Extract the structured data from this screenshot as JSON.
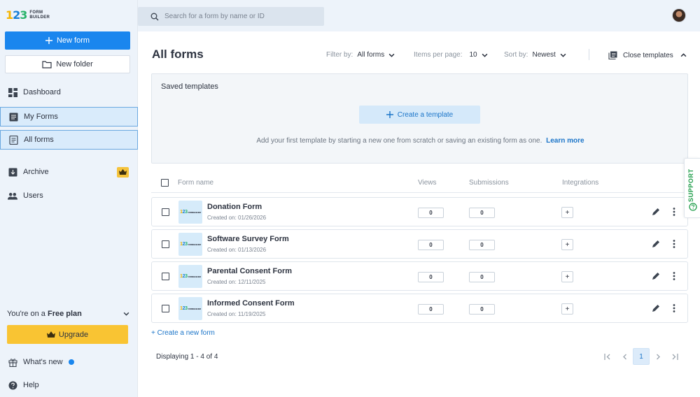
{
  "logo": {
    "digits": [
      "1",
      "2",
      "3"
    ],
    "line1": "FORM",
    "line2": "BUILDER"
  },
  "sidebar": {
    "new_form_label": "New form",
    "new_folder_label": "New folder",
    "items": [
      {
        "label": "Dashboard",
        "icon": "dashboard-icon"
      },
      {
        "label": "My Forms",
        "icon": "form-list-icon"
      },
      {
        "label": "All forms",
        "icon": "document-icon"
      },
      {
        "label": "Archive",
        "icon": "archive-icon"
      },
      {
        "label": "Users",
        "icon": "users-icon"
      }
    ],
    "plan_prefix": "You're on a",
    "plan_name": "Free plan",
    "upgrade_label": "Upgrade",
    "whats_new_label": "What's new",
    "help_label": "Help"
  },
  "search": {
    "placeholder": "Search for a form by name or ID"
  },
  "main": {
    "title": "All forms",
    "filter_label": "Filter by:",
    "filter_value": "All forms",
    "per_page_label": "Items per page:",
    "per_page_value": "10",
    "sort_label": "Sort by:",
    "sort_value": "Newest",
    "close_templates_label": "Close templates"
  },
  "templates": {
    "title": "Saved templates",
    "create_label": "Create a template",
    "help_text": "Add your first template by starting a new one from scratch or saving an existing form as one.",
    "learn_more": "Learn more"
  },
  "table": {
    "columns": [
      "Form name",
      "Views",
      "Submissions",
      "Integrations"
    ],
    "rows": [
      {
        "name": "Donation Form",
        "created": "Created on: 01/26/2026",
        "views": "0",
        "submissions": "0",
        "integrations": "+"
      },
      {
        "name": "Software Survey Form",
        "created": "Created on: 01/13/2026",
        "views": "0",
        "submissions": "0",
        "integrations": "+"
      },
      {
        "name": "Parental Consent Form",
        "created": "Created on: 12/11/2025",
        "views": "0",
        "submissions": "0",
        "integrations": "+"
      },
      {
        "name": "Informed Consent Form",
        "created": "Created on: 11/19/2025",
        "views": "0",
        "submissions": "0",
        "integrations": "+"
      }
    ],
    "thumb_logo": {
      "digits": [
        "1",
        "2",
        "3"
      ],
      "text": "FORM BUILDER"
    }
  },
  "footer": {
    "create_new_form": "+ Create a new form",
    "displaying": "Displaying 1 - 4 of 4",
    "current_page": "1"
  },
  "support": {
    "label": "SUPPORT"
  },
  "colors": {
    "accent": "#1a86ee",
    "link": "#1a74c8",
    "upgrade": "#f9c433",
    "support": "#1f9d4a"
  }
}
